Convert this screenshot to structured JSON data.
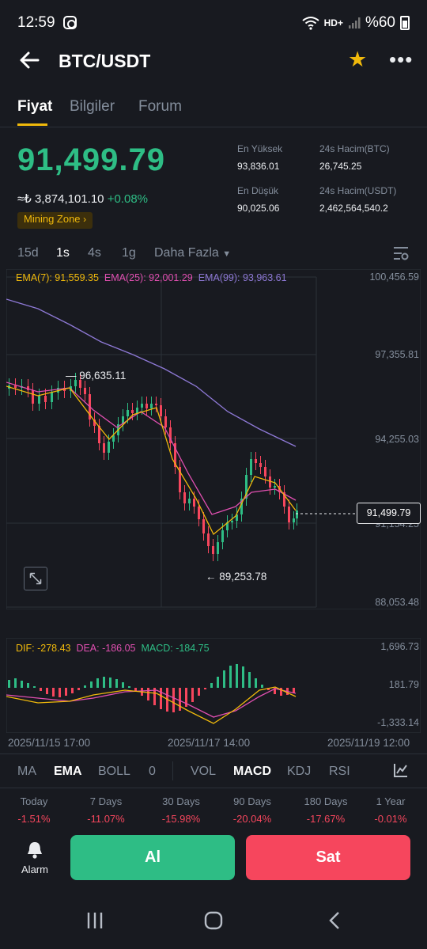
{
  "status": {
    "time": "12:59",
    "battery": "%60"
  },
  "header": {
    "title": "BTC/USDT"
  },
  "tabs": [
    "Fiyat",
    "Bilgiler",
    "Forum"
  ],
  "ticker": {
    "last_price": "91,499.79",
    "fiat_value": "≈₺ 3,874,101.10",
    "change": "+0.08%",
    "zone_label": "Mining Zone",
    "stats": {
      "high_label": "En Yüksek",
      "high_value": "93,836.01",
      "low_label": "En Düşük",
      "low_value": "90,025.06",
      "vol_btc_label": "24s Hacim(BTC)",
      "vol_btc_value": "26,745.25",
      "vol_usdt_label": "24s Hacim(USDT)",
      "vol_usdt_value": "2,462,564,540.2"
    }
  },
  "intervals": [
    "15d",
    "1s",
    "4s",
    "1g",
    "Daha Fazla"
  ],
  "main_chart": {
    "ema7": "EMA(7): 91,559.35",
    "ema25": "EMA(25): 92,001.29",
    "ema99": "EMA(99): 93,963.61",
    "axis": [
      "100,456.59",
      "97,355.81",
      "94,255.03",
      "91,154.25",
      "88,053.48"
    ],
    "current_price": "91,499.79",
    "high_marker": "96,635.11",
    "low_marker": "89,253.78"
  },
  "macd_chart": {
    "dif": "DIF: -278.43",
    "dea": "DEA: -186.05",
    "macd": "MACD: -184.75",
    "axis": [
      "1,696.73",
      "181.79",
      "-1,333.14"
    ]
  },
  "dates": [
    "2025/11/15 17:00",
    "2025/11/17 14:00",
    "2025/11/19 12:00"
  ],
  "indicators": [
    "MA",
    "EMA",
    "BOLL",
    "0",
    "VOL",
    "MACD",
    "KDJ",
    "RSI"
  ],
  "performance": [
    {
      "label": "Today",
      "value": "-1.51%"
    },
    {
      "label": "7 Days",
      "value": "-11.07%"
    },
    {
      "label": "30 Days",
      "value": "-15.98%"
    },
    {
      "label": "90 Days",
      "value": "-20.04%"
    },
    {
      "label": "180 Days",
      "value": "-17.67%"
    },
    {
      "label": "1 Year",
      "value": "-0.01%"
    }
  ],
  "actions": {
    "alarm": "Alarm",
    "buy": "Al",
    "sell": "Sat"
  },
  "colors": {
    "up": "#2ebd85",
    "down": "#f6465d",
    "accent": "#f0b90b",
    "ema7": "#f0b90b",
    "ema25": "#e04fb0",
    "ema99": "#8e79d6"
  }
}
